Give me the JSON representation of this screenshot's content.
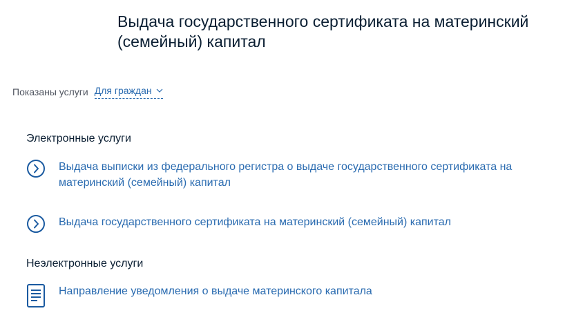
{
  "page": {
    "title": "Выдача государственного сертификата на материнский (семейный) капитал"
  },
  "filter": {
    "label": "Показаны услуги",
    "selected": "Для граждан"
  },
  "electronic": {
    "heading": "Электронные услуги",
    "items": [
      {
        "label": "Выдача выписки из федерального регистра о выдаче государственного сертификата на материнский (семейный) капитал",
        "icon": "chevron-circle-icon"
      },
      {
        "label": "Выдача государственного сертификата на материнский (семейный) капитал",
        "icon": "chevron-circle-icon"
      }
    ]
  },
  "non_electronic": {
    "heading": "Неэлектронные услуги",
    "items": [
      {
        "label": "Направление уведомления о выдаче материнского капитала",
        "icon": "document-icon"
      }
    ]
  },
  "colors": {
    "text": "#0b1f33",
    "link": "#2a6bb0",
    "muted": "#505560"
  }
}
